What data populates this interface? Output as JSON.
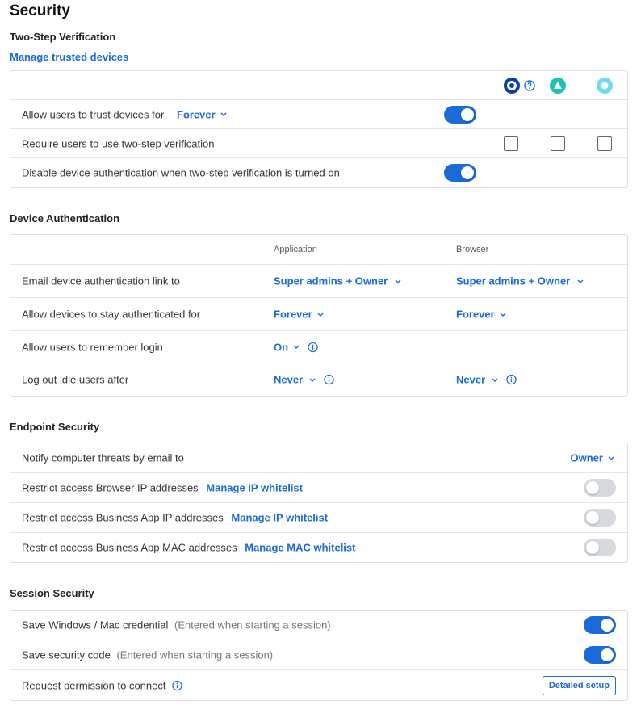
{
  "page": {
    "title": "Security"
  },
  "two_step": {
    "title": "Two-Step Verification",
    "manage_link": "Manage trusted devices",
    "header_icons": [
      "target-help-icon",
      "question-icon",
      "triangle-badge-icon",
      "ring-badge-icon"
    ],
    "rows": {
      "trust": {
        "label": "Allow users to trust devices for",
        "value": "Forever",
        "toggle": true
      },
      "require": {
        "label": "Require users to use two-step verification",
        "checkboxes": [
          false,
          false,
          false
        ]
      },
      "disable": {
        "label": "Disable device authentication when two-step verification is turned on",
        "toggle": true
      }
    }
  },
  "device_auth": {
    "title": "Device Authentication",
    "columns": {
      "application": "Application",
      "browser": "Browser"
    },
    "rows": {
      "email": {
        "label": "Email device authentication link to",
        "app": "Super admins + Owner",
        "browser": "Super admins + Owner"
      },
      "stay": {
        "label": "Allow devices to stay authenticated for",
        "app": "Forever",
        "browser": "Forever"
      },
      "remember": {
        "label": "Allow users to remember login",
        "app": "On"
      },
      "logout": {
        "label": "Log out idle users after",
        "app": "Never",
        "browser": "Never"
      }
    }
  },
  "endpoint": {
    "title": "Endpoint Security",
    "rows": {
      "notify": {
        "label": "Notify computer threats by email to",
        "value": "Owner"
      },
      "browser_ip": {
        "label": "Restrict access Browser IP addresses",
        "link": "Manage IP whitelist",
        "toggle": false
      },
      "app_ip": {
        "label": "Restrict access Business App IP addresses",
        "link": "Manage IP whitelist",
        "toggle": false
      },
      "app_mac": {
        "label": "Restrict access Business App MAC addresses",
        "link": "Manage MAC whitelist",
        "toggle": false
      }
    }
  },
  "session": {
    "title": "Session Security",
    "rows": {
      "credential": {
        "label": "Save Windows / Mac credential",
        "note": "(Entered when starting a session)",
        "toggle": true
      },
      "code": {
        "label": "Save security code",
        "note": "(Entered when starting a session)",
        "toggle": true
      },
      "permission": {
        "label": "Request permission to connect",
        "button": "Detailed setup"
      }
    }
  },
  "colors": {
    "accent": "#1a6ad9",
    "teal": "#1ec3b4",
    "cyan": "#6fdcea",
    "navy": "#0d3f9e",
    "toggle_off": "#d6d9dd"
  }
}
